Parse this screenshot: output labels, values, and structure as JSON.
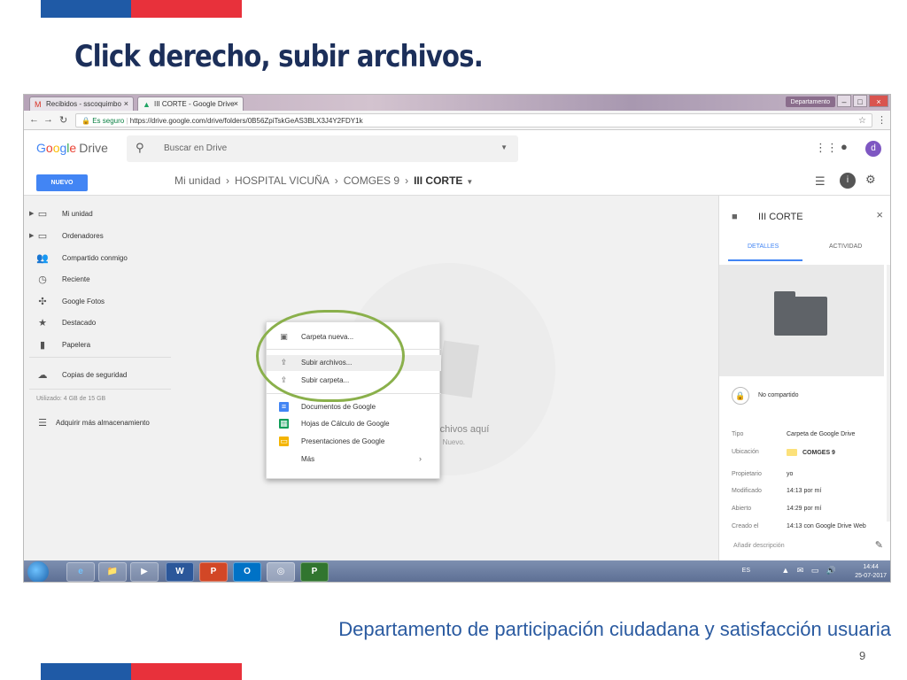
{
  "slide": {
    "title": "Click derecho, subir archivos.",
    "footer": "Departamento de participación ciudadana y satisfacción usuaria",
    "page_number": "9"
  },
  "browser": {
    "tabs": [
      {
        "label": "Recibidos - sscoquimbo",
        "icon": "gmail-icon"
      },
      {
        "label": "III CORTE - Google Drive",
        "icon": "drive-icon"
      }
    ],
    "secure_label": "Es seguro",
    "url": "https://drive.google.com/drive/folders/0B56ZpiTskGeAS3BLX3J4Y2FDY1k",
    "user_badge": "Departamento"
  },
  "drive": {
    "logo_text": "Drive",
    "search_placeholder": "Buscar en Drive",
    "new_button": "NUEVO",
    "avatar_letter": "d",
    "breadcrumb": [
      "Mi unidad",
      "HOSPITAL VICUÑA",
      "COMGES 9",
      "III CORTE"
    ],
    "sidebar": [
      {
        "label": "Mi unidad",
        "icon": "drive-folder-icon",
        "expandable": true
      },
      {
        "label": "Ordenadores",
        "icon": "computer-icon",
        "expandable": true
      },
      {
        "label": "Compartido conmigo",
        "icon": "people-icon",
        "expandable": false
      },
      {
        "label": "Reciente",
        "icon": "clock-icon",
        "expandable": false
      },
      {
        "label": "Google Fotos",
        "icon": "pinwheel-icon",
        "expandable": false
      },
      {
        "label": "Destacado",
        "icon": "star-icon",
        "expandable": false
      },
      {
        "label": "Papelera",
        "icon": "trash-icon",
        "expandable": false
      }
    ],
    "backups": "Copias de seguridad",
    "storage_used": "Utilizado: 4 GB de 15 GB",
    "buy_storage": "Adquirir más almacenamiento",
    "empty_state_title": "rchivos aquí",
    "empty_state_sub": "n Nuevo."
  },
  "context_menu": {
    "items": [
      {
        "label": "Carpeta nueva...",
        "icon": "new-folder-icon"
      },
      {
        "label": "Subir archivos...",
        "icon": "file-upload-icon",
        "hover": true
      },
      {
        "label": "Subir carpeta...",
        "icon": "folder-upload-icon"
      },
      {
        "label": "Documentos de Google",
        "icon": "google-docs-icon"
      },
      {
        "label": "Hojas de Cálculo de Google",
        "icon": "google-sheets-icon"
      },
      {
        "label": "Presentaciones de Google",
        "icon": "google-slides-icon"
      },
      {
        "label": "Más",
        "icon": "",
        "submenu": true
      }
    ]
  },
  "details_panel": {
    "title": "III CORTE",
    "tabs": [
      "DETALLES",
      "ACTIVIDAD"
    ],
    "sharing": "No compartido",
    "properties": [
      {
        "key": "Tipo",
        "value": "Carpeta de Google Drive"
      },
      {
        "key": "Ubicación",
        "value": "COMGES 9"
      },
      {
        "key": "Propietario",
        "value": "yo"
      },
      {
        "key": "Modificado",
        "value": "14:13 por mí"
      },
      {
        "key": "Abierto",
        "value": "14:29 por mí"
      },
      {
        "key": "Creado el",
        "value": "14:13 con Google Drive Web"
      }
    ],
    "add_description": "Añadir descripción"
  },
  "taskbar": {
    "apps": [
      "e",
      "📁",
      "▶",
      "W",
      "P",
      "O",
      "◎",
      "P"
    ],
    "language": "ES",
    "time": "14:44",
    "date": "25-07-2017"
  },
  "colors": {
    "flag_blue": "#1f5aa6",
    "flag_red": "#e8313b",
    "drive_blue": "#4285f4",
    "highlight_ring": "#8ab04b"
  }
}
